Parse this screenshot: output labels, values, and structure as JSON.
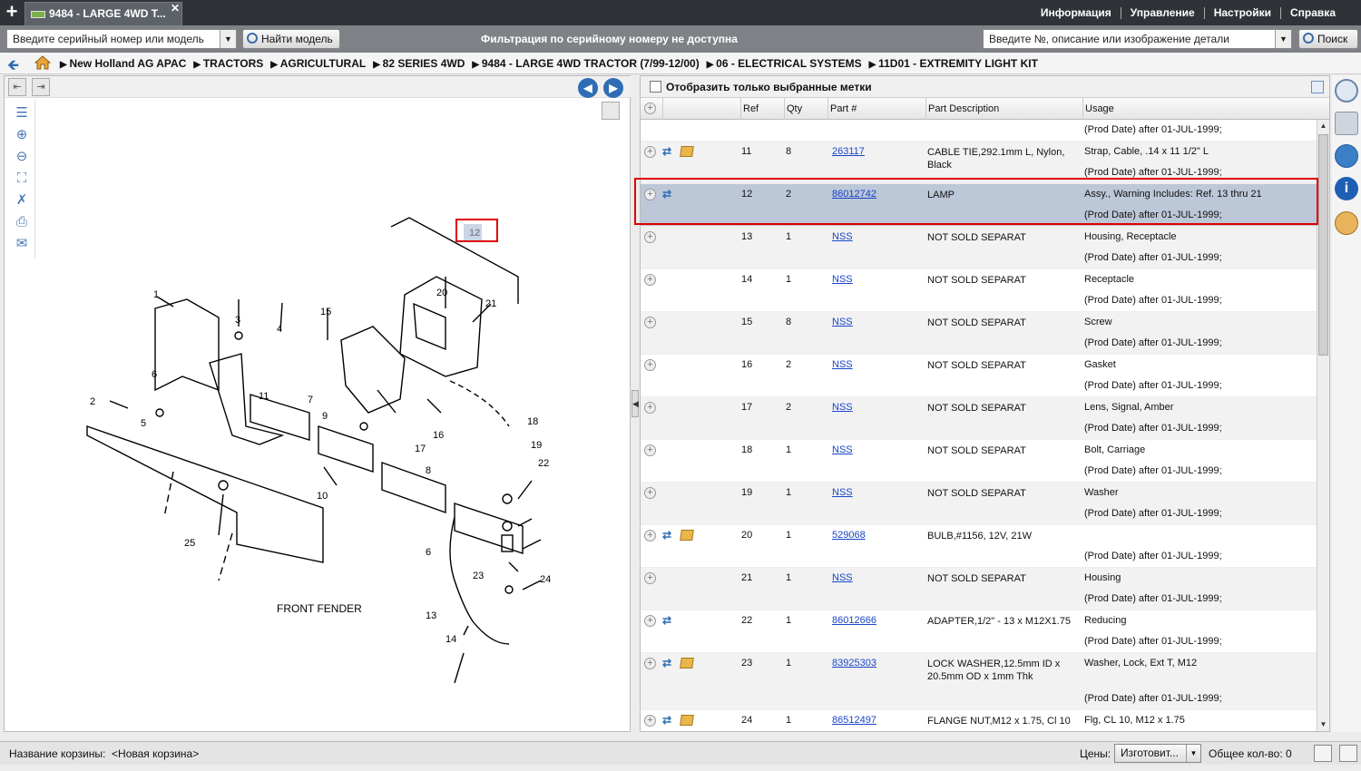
{
  "tab": {
    "title": "9484 - LARGE 4WD T..."
  },
  "menu": [
    "Информация",
    "Управление",
    "Настройки",
    "Справка"
  ],
  "search": {
    "model_placeholder": "Введите серийный номер или модель",
    "find_model_button": "Найти модель",
    "filter_status": "Фильтрация по серийному номеру не доступна",
    "part_placeholder": "Введите №, описание или изображение детали",
    "search_button": "Поиск"
  },
  "breadcrumb": [
    "New Holland AG APAC",
    "TRACTORS",
    "AGRICULTURAL",
    "82 SERIES 4WD",
    "9484 - LARGE 4WD TRACTOR (7/99-12/00)",
    "06 - ELECTRICAL SYSTEMS",
    "11D01 - EXTREMITY LIGHT KIT"
  ],
  "diagram": {
    "callouts": [
      "1",
      "2",
      "3",
      "4",
      "5",
      "6",
      "7",
      "8",
      "9",
      "10",
      "11",
      "12",
      "13",
      "14",
      "15",
      "16",
      "17",
      "18",
      "19",
      "20",
      "21",
      "22",
      "23",
      "24",
      "25",
      "6"
    ],
    "fender_label": "FRONT FENDER"
  },
  "parts_panel": {
    "filter_label": "Отобразить только выбранные метки",
    "columns": {
      "ref": "Ref",
      "qty": "Qty",
      "part": "Part #",
      "desc": "Part Description",
      "usage": "Usage"
    },
    "top_usage": "(Prod Date) after 01-JUL-1999;",
    "rows": [
      {
        "ref": "11",
        "qty": "8",
        "part": "263117",
        "desc": "CABLE TIE,292.1mm L, Nylon, Black",
        "usage": "Strap, Cable, .14 x 11 1/2\" L",
        "usage2": "(Prod Date) after 01-JUL-1999;",
        "swap": true,
        "box": true
      },
      {
        "ref": "12",
        "qty": "2",
        "part": "86012742",
        "desc": "LAMP",
        "usage": "Assy., Warning Includes: Ref. 13 thru 21",
        "usage2": "(Prod Date) after 01-JUL-1999;",
        "swap": true,
        "box": false,
        "selected": true
      },
      {
        "ref": "13",
        "qty": "1",
        "part": "NSS",
        "desc": "NOT SOLD SEPARAT",
        "usage": "Housing, Receptacle",
        "usage2": "(Prod Date) after 01-JUL-1999;"
      },
      {
        "ref": "14",
        "qty": "1",
        "part": "NSS",
        "desc": "NOT SOLD SEPARAT",
        "usage": "Receptacle",
        "usage2": "(Prod Date) after 01-JUL-1999;"
      },
      {
        "ref": "15",
        "qty": "8",
        "part": "NSS",
        "desc": "NOT SOLD SEPARAT",
        "usage": "Screw",
        "usage2": "(Prod Date) after 01-JUL-1999;"
      },
      {
        "ref": "16",
        "qty": "2",
        "part": "NSS",
        "desc": "NOT SOLD SEPARAT",
        "usage": "Gasket",
        "usage2": "(Prod Date) after 01-JUL-1999;"
      },
      {
        "ref": "17",
        "qty": "2",
        "part": "NSS",
        "desc": "NOT SOLD SEPARAT",
        "usage": "Lens, Signal, Amber",
        "usage2": "(Prod Date) after 01-JUL-1999;"
      },
      {
        "ref": "18",
        "qty": "1",
        "part": "NSS",
        "desc": "NOT SOLD SEPARAT",
        "usage": "Bolt, Carriage",
        "usage2": "(Prod Date) after 01-JUL-1999;"
      },
      {
        "ref": "19",
        "qty": "1",
        "part": "NSS",
        "desc": "NOT SOLD SEPARAT",
        "usage": "Washer",
        "usage2": "(Prod Date) after 01-JUL-1999;"
      },
      {
        "ref": "20",
        "qty": "1",
        "part": "529068",
        "desc": "BULB,#1156, 12V, 21W",
        "usage": "",
        "usage2": "(Prod Date) after 01-JUL-1999;",
        "swap": true,
        "box": true
      },
      {
        "ref": "21",
        "qty": "1",
        "part": "NSS",
        "desc": "NOT SOLD SEPARAT",
        "usage": "Housing",
        "usage2": "(Prod Date) after 01-JUL-1999;"
      },
      {
        "ref": "22",
        "qty": "1",
        "part": "86012666",
        "desc": "ADAPTER,1/2\" - 13 x M12X1.75",
        "usage": "Reducing",
        "usage2": "(Prod Date) after 01-JUL-1999;",
        "swap": true
      },
      {
        "ref": "23",
        "qty": "1",
        "part": "83925303",
        "desc": "LOCK WASHER,12.5mm ID x 20.5mm OD x 1mm Thk",
        "usage": "Washer, Lock, Ext T, M12",
        "usage2": "(Prod Date) after 01-JUL-1999;",
        "swap": true,
        "box": true,
        "tall": true
      },
      {
        "ref": "24",
        "qty": "1",
        "part": "86512497",
        "desc": "FLANGE NUT,M12 x 1.75, Cl 10",
        "usage": "Flg, CL 10, M12 x 1.75",
        "usage2": "",
        "swap": true,
        "box": true
      }
    ]
  },
  "status": {
    "cart_label": "Название корзины:",
    "cart_name": "<Новая корзина>",
    "price_label": "Цены:",
    "price_value": "Изготовит...",
    "total_qty": "Общее кол-во: 0"
  }
}
